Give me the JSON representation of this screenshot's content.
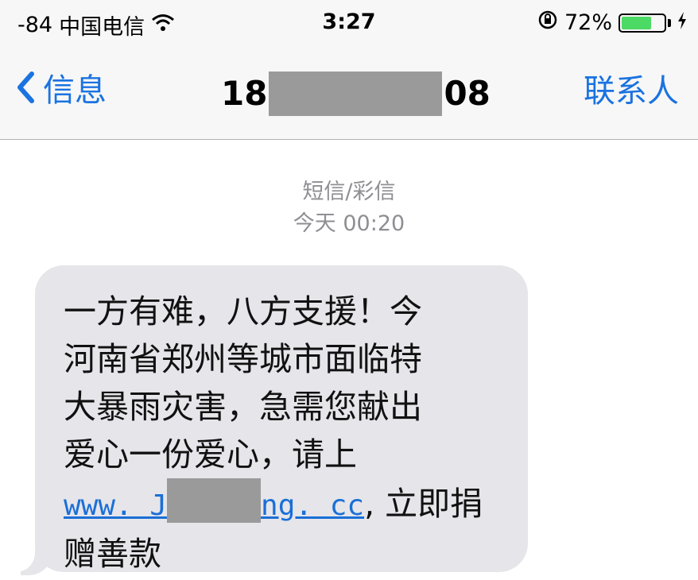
{
  "status_bar": {
    "signal": "-84",
    "carrier": "中国电信",
    "time": "3:27",
    "battery_percent": "72%",
    "battery_level": 0.72
  },
  "nav": {
    "back_label": "信息",
    "title_prefix": "18",
    "title_suffix": "08",
    "contact_label": "联系人"
  },
  "meta": {
    "type_label": "短信/彩信",
    "timestamp": "今天 00:20"
  },
  "message": {
    "lines": [
      "一方有难，八方支援！今",
      "河南省郑州等城市面临特",
      "大暴雨灾害，急需您献出",
      "爱心一份爱心，请上"
    ],
    "link_prefix": "www. J",
    "link_suffix": "ng. cc",
    "after_link": ", 立即捐",
    "last_line": "赠善款"
  }
}
